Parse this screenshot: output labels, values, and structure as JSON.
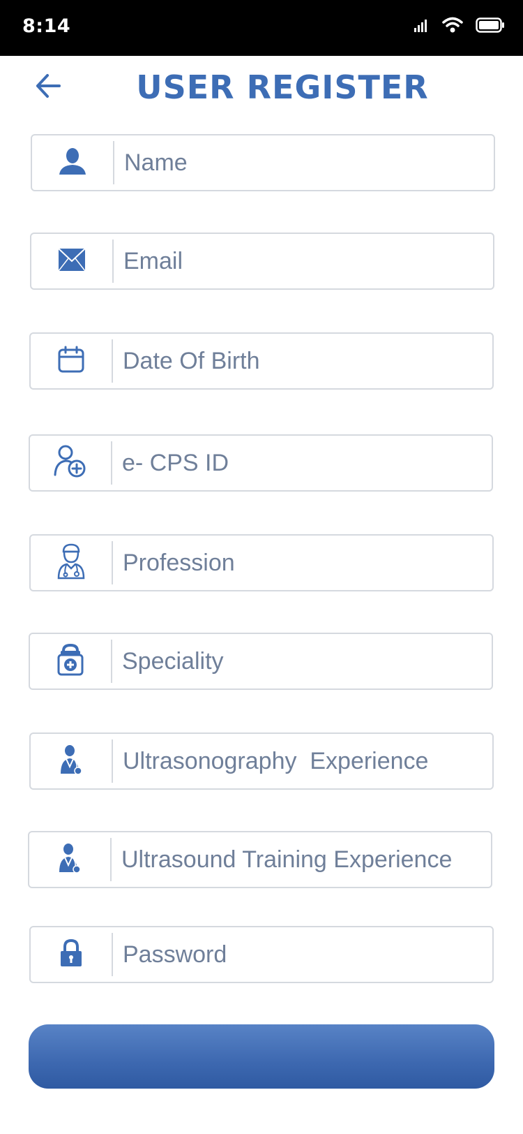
{
  "status_bar": {
    "time": "8:14",
    "icons": [
      "signal-icon",
      "wifi-icon",
      "battery-icon"
    ]
  },
  "header": {
    "title": "USER REGISTER",
    "back_icon": "arrow-left-icon"
  },
  "form": {
    "fields": [
      {
        "name": "name-input",
        "icon": "person-icon",
        "placeholder": "Name",
        "value": ""
      },
      {
        "name": "email-input",
        "icon": "envelope-icon",
        "placeholder": "Email",
        "value": ""
      },
      {
        "name": "dob-input",
        "icon": "calendar-icon",
        "placeholder": "Date Of Birth",
        "value": ""
      },
      {
        "name": "ecps-id-input",
        "icon": "user-add-icon",
        "placeholder": "e- CPS ID",
        "value": ""
      },
      {
        "name": "profession-input",
        "icon": "doctor-icon",
        "placeholder": "Profession",
        "value": ""
      },
      {
        "name": "speciality-input",
        "icon": "medical-kit-icon",
        "placeholder": "Speciality",
        "value": ""
      },
      {
        "name": "usg-experience-input",
        "icon": "doctor-stethoscope-icon",
        "placeholder": "Ultrasonography  Experience",
        "value": ""
      },
      {
        "name": "training-experience-input",
        "icon": "doctor-stethoscope-icon",
        "placeholder": "Ultrasound Training Experience",
        "value": ""
      },
      {
        "name": "password-input",
        "icon": "lock-icon",
        "placeholder": "Password",
        "value": ""
      }
    ]
  },
  "submit": {
    "label": ""
  },
  "colors": {
    "accent": "#3d6db5",
    "border": "#d5d9df",
    "placeholder": "#6f7f99",
    "button_top": "#5883c6",
    "button_bottom": "#2f5aa2"
  }
}
